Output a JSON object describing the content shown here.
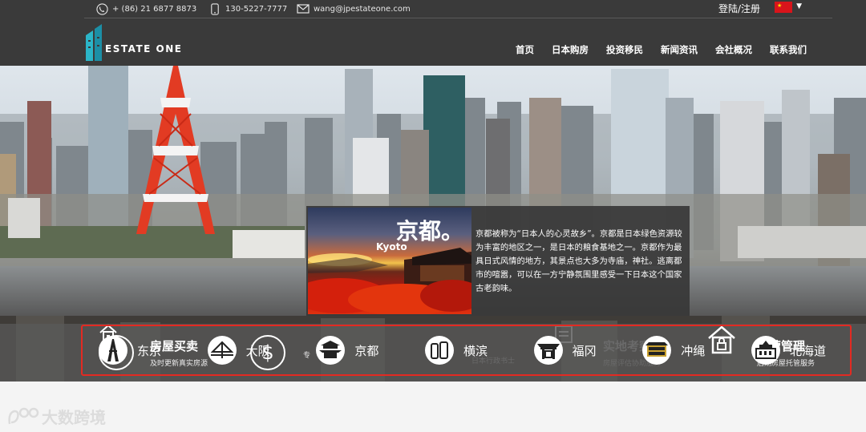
{
  "topbar": {
    "phone": "+ (86) 21 6877 8873",
    "mobile": "130-5227-7777",
    "email": "wang@jpestateone.com",
    "login": "登陆/注册"
  },
  "logo": {
    "text": "ESTATE ONE"
  },
  "nav": [
    "首页",
    "日本购房",
    "投资移民",
    "新闻资讯",
    "会社概况",
    "联系我们"
  ],
  "services": [
    {
      "title": "房屋买卖",
      "subtitle": "及时更新真实房源"
    },
    {
      "title": "",
      "subtitle": "专"
    },
    {
      "title": "",
      "subtitle": "日本行政书士"
    },
    {
      "title": "实地考察",
      "subtitle": "房屋评估协助服务"
    },
    {
      "title": "运营管理",
      "subtitle": "后期房屋托管服务"
    }
  ],
  "popup": {
    "title": "京都。",
    "subtitle": "Kyoto",
    "description": "京都被称为“日本人的心灵故乡”。京都是日本绿色资源较为丰富的地区之一，是日本的粮食基地之一。京都作为最具日式风情的地方，其景点也大多为寺庙，神社。逃离都市的喧嚣，可以在一方宁静氛围里感受一下日本这个国家古老韵味。"
  },
  "cities": [
    "东京",
    "大阪",
    "京都",
    "横滨",
    "福冈",
    "冲绳",
    "北海道"
  ],
  "watermark": "大数跨境",
  "colors": {
    "header_bg": "#3a3a3a",
    "accent_teal": "#2bb5c8",
    "highlight_red": "#e32a22"
  }
}
